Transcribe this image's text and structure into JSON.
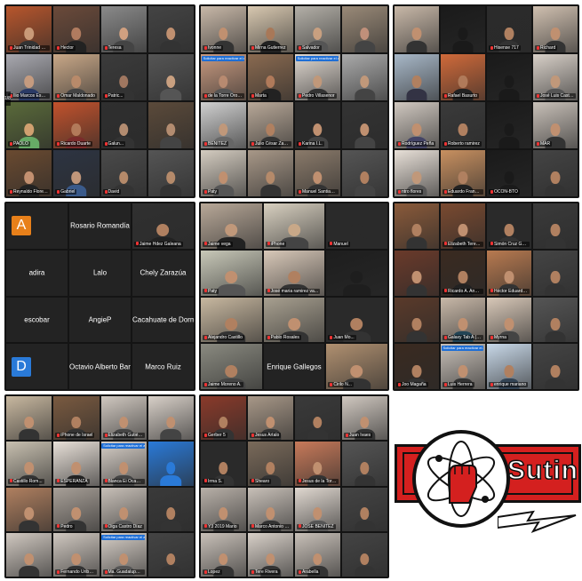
{
  "colors": {
    "accent_red": "#d4201f",
    "active_speaker": "#e8d63a",
    "unmute_blue": "#1f6fd6"
  },
  "panels": [
    {
      "id": "p1",
      "cols": 4,
      "rows": 4,
      "pager": "1/8",
      "tiles": [
        {
          "name": "Juan Trinidad Rivera Dí...",
          "bg": "#b8562c",
          "skin": "#c99a78",
          "shirt": "#333"
        },
        {
          "name": "Hector",
          "bg": "#6b4a3a",
          "skin": "#b07b5f",
          "shirt": "#222"
        },
        {
          "name": "Teresa",
          "bg": "#8a8a8a",
          "skin": "#d0a080",
          "shirt": "#444"
        },
        {
          "name": "",
          "bg": "#444",
          "skin": "#c09070",
          "shirt": "#333"
        },
        {
          "name": "Ilio Marcos Esperanza...",
          "bg": "#a9a9b0",
          "skin": "#c59b7f",
          "shirt": "#2a3a66"
        },
        {
          "name": "Omar Maldonado",
          "bg": "#c9a888",
          "skin": "#b88a6a",
          "shirt": "#444"
        },
        {
          "name": "Patric...",
          "bg": "#3b3b3b",
          "skin": "#a07760",
          "shirt": "#333"
        },
        {
          "name": "",
          "bg": "#555",
          "skin": "#c9a080",
          "shirt": "#555"
        },
        {
          "name": "PAOLO",
          "bg": "#5a6a3a",
          "skin": "#d0a070",
          "shirt": "#6a6"
        },
        {
          "name": "Ricardo Duarte",
          "bg": "#c2522c",
          "skin": "#b27a5a",
          "shirt": "#7a2b2b"
        },
        {
          "name": "Galun...",
          "bg": "#2f2f2f",
          "skin": "#b38c70",
          "shirt": "#333"
        },
        {
          "name": "",
          "bg": "#5b4a3a",
          "skin": "#b38c70",
          "shirt": "#444"
        },
        {
          "name": "Reynaldo Flores Ferrer",
          "bg": "#6a4a30",
          "skin": "#c39070",
          "shirt": "#222"
        },
        {
          "name": "Gabriel",
          "bg": "#2d3442",
          "skin": "#c0967a",
          "shirt": "#3a5a8a"
        },
        {
          "name": "David",
          "bg": "#4a4a4a",
          "skin": "#b58a6a",
          "shirt": "#333"
        },
        {
          "name": "",
          "bg": "#555",
          "skin": "#b58a6a",
          "shirt": "#333"
        }
      ]
    },
    {
      "id": "p2",
      "cols": 4,
      "rows": 4,
      "tiles": [
        {
          "name": "Ivonne",
          "bg": "#c8b8a8",
          "skin": "#c09070",
          "shirt": "#333"
        },
        {
          "name": "Mirna Gutierrez",
          "bg": "#d8c8b0",
          "skin": "#a87858",
          "shirt": "#222"
        },
        {
          "name": "Salvador",
          "bg": "#b4b0a8",
          "skin": "#c8a080",
          "shirt": "#555"
        },
        {
          "name": "",
          "bg": "#9a8a78",
          "skin": "#c0907a",
          "shirt": "#444"
        },
        {
          "name": "de la Torre Orozco",
          "bg": "#c89a80",
          "skin": "#b88a70",
          "shirt": "#555",
          "unmute": "Solicitar para reactivar el audio"
        },
        {
          "name": "Marta",
          "bg": "#8a6a50",
          "skin": "#b07a5a",
          "shirt": "#222"
        },
        {
          "name": "Pedro Villasenor",
          "bg": "#e0d8d0",
          "skin": "#c0987a",
          "shirt": "#333",
          "unmute": "Solicitar para reactivar el audio"
        },
        {
          "name": "",
          "bg": "#aaa",
          "skin": "#c0987a",
          "shirt": "#444"
        },
        {
          "name": "BENITEZ",
          "bg": "#d0d0d0",
          "skin": "#c0987a",
          "shirt": "#666"
        },
        {
          "name": "Julio César Zamora",
          "bg": "#b8a898",
          "skin": "#b08060",
          "shirt": "#333"
        },
        {
          "name": "Karina I.L.",
          "bg": "#2a2a2a",
          "skin": "#c09070",
          "shirt": "#444"
        },
        {
          "name": "",
          "bg": "#333",
          "skin": "#c09070",
          "shirt": "#444"
        },
        {
          "name": "Paty",
          "bg": "#d4ccc0",
          "skin": "#c09070",
          "shirt": "#555"
        },
        {
          "name": "",
          "bg": "#a89888",
          "skin": "#b58a6a",
          "shirt": "#333"
        },
        {
          "name": "Manuel Santiago y Fide...",
          "bg": "#8a7a6a",
          "skin": "#c09070",
          "shirt": "#333"
        },
        {
          "name": "",
          "bg": "#555",
          "skin": "#b08060",
          "shirt": "#444"
        }
      ]
    },
    {
      "id": "p3",
      "cols": 4,
      "rows": 4,
      "tiles": [
        {
          "name": "",
          "bg": "#c8b8a8",
          "skin": "#c09070",
          "shirt": "#333"
        },
        {
          "name": "",
          "bg": "#1a1a1a",
          "skin": "#1a1a1a",
          "shirt": "#1a1a1a"
        },
        {
          "name": "Hisense 717",
          "bg": "#2b2b2b",
          "skin": "#b08060",
          "shirt": "#333"
        },
        {
          "name": "Richard",
          "bg": "#d0c0b0",
          "skin": "#c09070",
          "shirt": "#333"
        },
        {
          "name": "",
          "bg": "#a8b8c8",
          "skin": "#b08060",
          "shirt": "#334"
        },
        {
          "name": "Rafael Basurto",
          "bg": "#d06a3a",
          "skin": "#b07a5a",
          "shirt": "#222"
        },
        {
          "name": "",
          "bg": "#1a1a1a",
          "skin": "#1a1a1a",
          "shirt": "#1a1a1a"
        },
        {
          "name": "José Luis Castillo Re...",
          "bg": "#d8d0c8",
          "skin": "#c0987a",
          "shirt": "#555"
        },
        {
          "name": "Rodríguez Peña",
          "bg": "#d0c8c0",
          "skin": "#c09070",
          "shirt": "#446"
        },
        {
          "name": "Roberto ramirez",
          "bg": "#3a3a3a",
          "skin": "#b08060",
          "shirt": "#333"
        },
        {
          "name": "",
          "bg": "#1a1a1a",
          "skin": "#1a1a1a",
          "shirt": "#1a1a1a"
        },
        {
          "name": "MAR",
          "bg": "#c8c0b8",
          "skin": "#c09070",
          "shirt": "#333"
        },
        {
          "name": "ntro flores",
          "bg": "#e8e0d8",
          "skin": "#c0987a",
          "shirt": "#555"
        },
        {
          "name": "Eduardo Francisco Rob...",
          "bg": "#c89060",
          "skin": "#b08060",
          "shirt": "#222"
        },
        {
          "name": "OCON-BTO",
          "bg": "#1a1a1a",
          "skin": "#1a1a1a",
          "shirt": "#1a1a1a"
        },
        {
          "name": "",
          "bg": "#444",
          "skin": "#b08060",
          "shirt": "#333"
        }
      ]
    },
    {
      "id": "p4",
      "cols": 3,
      "rows": 4,
      "tiles": [
        {
          "dark": true,
          "initial": "A",
          "initial_bg": "#e8801a",
          "big": "",
          "name": ""
        },
        {
          "dark": true,
          "big": "Rosario Romandía",
          "name": ""
        },
        {
          "name": "Jaime Hdez Galeana",
          "bg": "#303030",
          "skin": "#b08060",
          "shirt": "#222"
        },
        {
          "dark": true,
          "big": "adira",
          "name": ""
        },
        {
          "dark": true,
          "big": "Lalo",
          "name": ""
        },
        {
          "dark": true,
          "big": "Chely Zarazúa",
          "name": ""
        },
        {
          "dark": true,
          "big": "escobar",
          "name": ""
        },
        {
          "dark": true,
          "big": "AngieP",
          "name": ""
        },
        {
          "dark": true,
          "big": "Cacahuate de Dorm...",
          "name": ""
        },
        {
          "dark": true,
          "initial": "D",
          "initial_bg": "#2a7ad8",
          "big": "",
          "name": ""
        },
        {
          "dark": true,
          "big": "Octavio Alberto Barr...",
          "name": ""
        },
        {
          "dark": true,
          "big": "Marco Ruiz",
          "name": ""
        }
      ]
    },
    {
      "id": "p5",
      "cols": 3,
      "rows": 4,
      "tiles": [
        {
          "name": "Jaime vega",
          "bg": "#b8a898",
          "skin": "#c0987a",
          "shirt": "#222",
          "active": true
        },
        {
          "name": "iPhone",
          "bg": "#d8d0c0",
          "skin": "#c8a888",
          "shirt": "#444"
        },
        {
          "name": "Manuel",
          "bg": "#2a2a2a",
          "skin": "#2a2a2a",
          "shirt": "#2a2a2a",
          "active": true
        },
        {
          "name": "Paty",
          "bg": "#c8c8b8",
          "skin": "#c09070",
          "shirt": "#555"
        },
        {
          "name": "José maria ramirez va...",
          "bg": "#d8c8b8",
          "skin": "#b08060",
          "shirt": "#333"
        },
        {
          "name": "",
          "bg": "#1e1e1e",
          "skin": "#1e1e1e",
          "shirt": "#1e1e1e"
        },
        {
          "name": "Alejandro Castillo",
          "bg": "#c8b8a0",
          "skin": "#b08060",
          "shirt": "#333"
        },
        {
          "name": "Pablo Rosales",
          "bg": "#a8a090",
          "skin": "#c09070",
          "shirt": "#333"
        },
        {
          "name": "Juan Mo...",
          "bg": "#2a2a2a",
          "skin": "#b08060",
          "shirt": "#333"
        },
        {
          "name": "Jaime Moreno A.",
          "bg": "#8a8a80",
          "skin": "#b08060",
          "shirt": "#444"
        },
        {
          "dark": true,
          "big": "Enrique Gallegos",
          "name": ""
        },
        {
          "name": "Cirilo N...",
          "bg": "#b09070",
          "skin": "#c09070",
          "shirt": "#333"
        }
      ]
    },
    {
      "id": "p6",
      "cols": 4,
      "rows": 4,
      "tiles": [
        {
          "name": "",
          "bg": "#8a5a3a",
          "skin": "#b08060",
          "shirt": "#333"
        },
        {
          "name": "Elizabeth Teresita Rom...",
          "bg": "#7a4a30",
          "skin": "#c09070",
          "shirt": "#222"
        },
        {
          "name": "Simón Cruz Galindo",
          "bg": "#2a2a2a",
          "skin": "#b08060",
          "shirt": "#333"
        },
        {
          "name": "",
          "bg": "#3a3a3a",
          "skin": "#b08060",
          "shirt": "#333"
        },
        {
          "name": "",
          "bg": "#6a3a2a",
          "skin": "#c09070",
          "shirt": "#333"
        },
        {
          "name": "Ricardo A. Anaya M.",
          "bg": "#3a2a20",
          "skin": "#b08060",
          "shirt": "#222"
        },
        {
          "name": "Héctor Eduardo Consl...",
          "bg": "#b87a50",
          "skin": "#c09070",
          "shirt": "#333"
        },
        {
          "name": "",
          "bg": "#444",
          "skin": "#b08060",
          "shirt": "#333"
        },
        {
          "name": "",
          "bg": "#5a3a2a",
          "skin": "#b08060",
          "shirt": "#333"
        },
        {
          "name": "Galaxy Tab A (2017)",
          "bg": "#c8b8a8",
          "skin": "#c09070",
          "shirt": "#245"
        },
        {
          "name": "Myrna",
          "bg": "#d8c8b8",
          "skin": "#c09070",
          "shirt": "#444"
        },
        {
          "name": "",
          "bg": "#555",
          "skin": "#b08060",
          "shirt": "#333"
        },
        {
          "name": "Joo Magaña",
          "bg": "#3a2a20",
          "skin": "#b08060",
          "shirt": "#333"
        },
        {
          "name": "Luis Herrera",
          "bg": "#c8c0b8",
          "skin": "#c09070",
          "shirt": "#333",
          "unmute": "Solicitar para reactivar el audio"
        },
        {
          "name": "enrique mariano",
          "bg": "#c8d8e8",
          "skin": "#b08060",
          "shirt": "#345"
        },
        {
          "name": "",
          "bg": "#444",
          "skin": "#b08060",
          "shirt": "#333"
        }
      ]
    },
    {
      "id": "p7",
      "cols": 4,
      "rows": 4,
      "tiles": [
        {
          "name": "",
          "bg": "#c8b8a0",
          "skin": "#c09070",
          "shirt": "#333"
        },
        {
          "name": "iPhone de Israel",
          "bg": "#7a5a40",
          "skin": "#b08060",
          "shirt": "#333"
        },
        {
          "name": "Elizabeth Gutiérrez Lá...",
          "bg": "#d0c8c0",
          "skin": "#c09070",
          "shirt": "#444"
        },
        {
          "name": "",
          "bg": "#d8d0c8",
          "skin": "#c09070",
          "shirt": "#444"
        },
        {
          "name": "Castillo Rom...",
          "bg": "#c8c0b0",
          "skin": "#c09070",
          "shirt": "#333"
        },
        {
          "name": "ESPERANZA",
          "bg": "#e8e0d8",
          "skin": "#c09070",
          "shirt": "#222"
        },
        {
          "name": "Blanca Ei Ocampo Gu...",
          "bg": "#d8d0c8",
          "skin": "#c09070",
          "shirt": "#444",
          "unmute": "Solicitar para reactivar el audio"
        },
        {
          "name": "",
          "bg": "#2a7ad8",
          "skin": "#2a7ad8",
          "shirt": "#2a7ad8"
        },
        {
          "name": "",
          "bg": "#b08060",
          "skin": "#c09070",
          "shirt": "#333"
        },
        {
          "name": "Pedro",
          "bg": "#a8a098",
          "skin": "#c09070",
          "shirt": "#333"
        },
        {
          "name": "Olga Castro Díaz",
          "bg": "#c8c0b8",
          "skin": "#c09070",
          "shirt": "#555"
        },
        {
          "name": "",
          "bg": "#3a3a3a",
          "skin": "#b08060",
          "shirt": "#333"
        },
        {
          "name": "",
          "bg": "#d0c8c0",
          "skin": "#c09070",
          "shirt": "#333"
        },
        {
          "name": "Fernando Uribe Ibarra",
          "bg": "#d0c8c0",
          "skin": "#c09070",
          "shirt": "#333"
        },
        {
          "name": "Ma. Guadalupe Ortega R...",
          "bg": "#d8d0c8",
          "skin": "#c09070",
          "shirt": "#555",
          "unmute": "Solicitar para reactivar el audio"
        },
        {
          "name": "",
          "bg": "#444",
          "skin": "#b08060",
          "shirt": "#333"
        }
      ]
    },
    {
      "id": "p8",
      "cols": 4,
      "rows": 4,
      "tiles": [
        {
          "name": "Gerber 5",
          "bg": "#8a3a2a",
          "skin": "#b08060",
          "shirt": "#333"
        },
        {
          "name": "Jesus Artalo",
          "bg": "#a89888",
          "skin": "#c09070",
          "shirt": "#333"
        },
        {
          "name": "",
          "bg": "#3a3a3a",
          "skin": "#b08060",
          "shirt": "#333"
        },
        {
          "name": "Juan Ivaes",
          "bg": "#d0c8c0",
          "skin": "#c09070",
          "shirt": "#333"
        },
        {
          "name": "Irma S.",
          "bg": "#2a2a2a",
          "skin": "#b08060",
          "shirt": "#333"
        },
        {
          "name": "Shearo",
          "bg": "#7a6a5a",
          "skin": "#b08060",
          "shirt": "#333"
        },
        {
          "name": "Jesus de la Torre Orozco",
          "bg": "#c87a5a",
          "skin": "#c09070",
          "shirt": "#333"
        },
        {
          "name": "",
          "bg": "#555",
          "skin": "#b08060",
          "shirt": "#333"
        },
        {
          "name": "Y3 2019 Mario",
          "bg": "#b8b0a8",
          "skin": "#c09070",
          "shirt": "#333"
        },
        {
          "name": "Marco Antonio López...",
          "bg": "#c8c0b8",
          "skin": "#c09070",
          "shirt": "#333"
        },
        {
          "name": "JOSE BENITEZ",
          "bg": "#e0d8d0",
          "skin": "#c09070",
          "shirt": "#555"
        },
        {
          "name": "",
          "bg": "#444",
          "skin": "#b08060",
          "shirt": "#333"
        },
        {
          "name": "Lopez",
          "bg": "#c8c0b8",
          "skin": "#c09070",
          "shirt": "#333"
        },
        {
          "name": "Tere Rivera",
          "bg": "#d8d0c8",
          "skin": "#c09070",
          "shirt": "#333"
        },
        {
          "name": "Arabella",
          "bg": "#c8c0b8",
          "skin": "#c09070",
          "shirt": "#333"
        },
        {
          "name": "",
          "bg": "#444",
          "skin": "#b08060",
          "shirt": "#333"
        }
      ]
    }
  ],
  "logo": {
    "text": "Sutin",
    "icon": "atom-fist-icon"
  }
}
